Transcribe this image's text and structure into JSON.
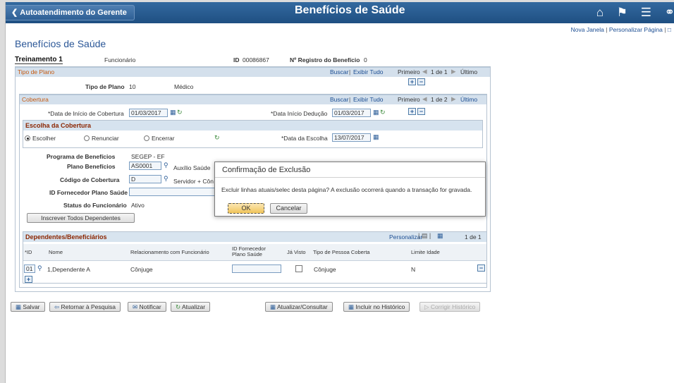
{
  "header": {
    "back_label": "Autoatendimento do Gerente",
    "title": "Benefícios de Saúde",
    "icons": [
      "home-icon",
      "flag-icon",
      "menu-icon",
      "navbar-icon"
    ]
  },
  "top_links": {
    "new_window": "Nova Janela",
    "personalize": "Personalizar Página"
  },
  "page_title": "Benefícios de Saúde",
  "employee": {
    "name": "Treinamento 1",
    "role": "Funcionário",
    "id_label": "ID",
    "id_value": "00086867",
    "reg_label": "Nº Registro do Benefício",
    "reg_value": "0"
  },
  "plan_type": {
    "band": "Tipo de Plano",
    "find": "Buscar",
    "view_all": "Exibir Tudo",
    "first": "Primeiro",
    "count": "1 de 1",
    "last": "Último",
    "label": "Tipo de Plano",
    "value": "10",
    "desc": "Médico"
  },
  "coverage": {
    "band": "Cobertura",
    "find": "Buscar",
    "view_all": "Exibir Tudo",
    "first": "Primeiro",
    "count": "1 de 2",
    "last": "Último",
    "start_label": "*Data de Início de Cobertura",
    "start_value": "01/03/2017",
    "deduction_label": "*Data Início Dedução",
    "deduction_value": "01/03/2017"
  },
  "election": {
    "band": "Escolha da Cobertura",
    "opt_elect": "Escolher",
    "opt_waive": "Renunciar",
    "opt_terminate": "Encerrar",
    "date_label": "*Data da Escolha",
    "date_value": "13/07/2017"
  },
  "details": {
    "program_label": "Programa de Benefícios",
    "program_value": "SEGEP - EF",
    "plan_label": "Plano Benefícios",
    "plan_value": "AS0001",
    "plan_desc": "Auxílio Saúde",
    "coverage_code_label": "Código de Cobertura",
    "coverage_code_value": "D",
    "coverage_code_desc": "Servidor + Côn",
    "provider_label": "ID Fornecedor Plano Saúde",
    "provider_value": "",
    "status_label": "Status do Funcionário",
    "status_value": "Ativo",
    "enroll_all": "Inscrever Todos Dependentes"
  },
  "dependents": {
    "band": "Dependentes/Beneficiários",
    "personalize": "Personalizar",
    "count": "1 de 1",
    "columns": {
      "id": "*ID",
      "name": "Nome",
      "relationship": "Relacionamento com Funcionário",
      "provider_1": "ID Fornecedor",
      "provider_2": "Plano Saúde",
      "seen": "Já Visto",
      "person_type": "Tipo de Pessoa Coberta",
      "age_limit": "Limite Idade"
    },
    "rows": [
      {
        "id": "01",
        "name": "1,Dependente A",
        "relationship": "Cônjuge",
        "provider": "",
        "person_type": "Cônjuge",
        "age_limit": "N"
      }
    ]
  },
  "toolbar": {
    "save": "Salvar",
    "return": "Retornar à Pesquisa",
    "notify": "Notificar",
    "refresh": "Atualizar",
    "update_display": "Atualizar/Consultar",
    "include_history": "Incluir no Histórico",
    "correct_history": "Corrigir Histórico"
  },
  "modal": {
    "title": "Confirmação de Exclusão",
    "message": "Excluir linhas atuais/selec desta página? A exclusão ocorrerá quando a transação for gravada.",
    "ok": "OK",
    "cancel": "Cancelar"
  }
}
